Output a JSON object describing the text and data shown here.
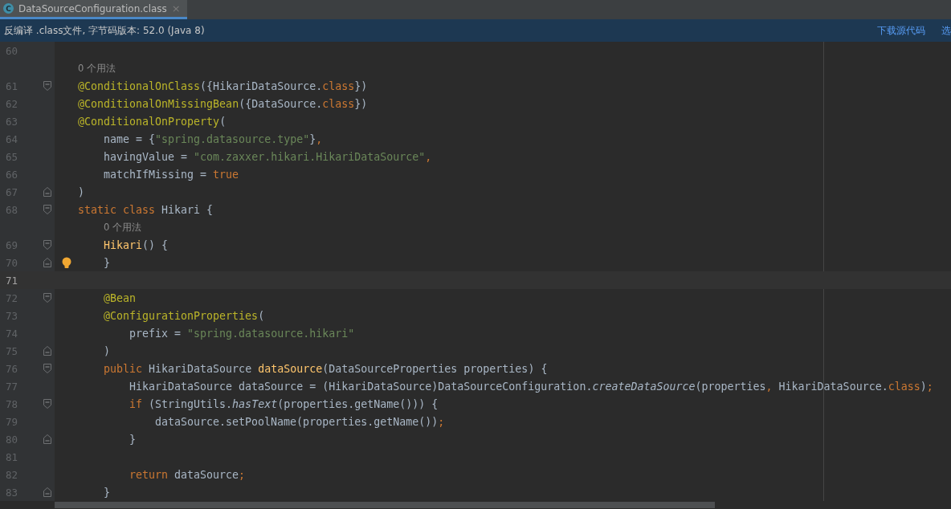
{
  "tab": {
    "icon": "C",
    "title": "DataSourceConfiguration.class",
    "close": "×",
    "selected": true
  },
  "info_bar": {
    "message": "反编译 .class文件, 字节码版本: 52.0 (Java 8)",
    "links": [
      "下载源代码",
      "选"
    ]
  },
  "lines": [
    {
      "kind": "code",
      "number": "60",
      "block_start": false,
      "block_end": false,
      "bulb": false,
      "current": false
    },
    {
      "kind": "hint",
      "text": "0 个用法"
    },
    {
      "kind": "code",
      "number": "61",
      "block_start": true,
      "block_end": false,
      "bulb": false,
      "current": false,
      "tokens": [
        {
          "kind": "annotation",
          "text": "@ConditionalOnClass"
        },
        {
          "kind": "plain",
          "text": "({HikariDataSource."
        },
        {
          "kind": "keyword",
          "text": "class"
        },
        {
          "kind": "plain",
          "text": "})"
        }
      ]
    },
    {
      "kind": "code",
      "number": "62",
      "block_start": false,
      "block_end": false,
      "bulb": false,
      "current": false,
      "tokens": [
        {
          "kind": "annotation",
          "text": "@ConditionalOnMissingBean"
        },
        {
          "kind": "plain",
          "text": "({DataSource."
        },
        {
          "kind": "keyword",
          "text": "class"
        },
        {
          "kind": "plain",
          "text": "})"
        }
      ]
    },
    {
      "kind": "code",
      "number": "63",
      "block_start": false,
      "block_end": false,
      "bulb": false,
      "current": false,
      "tokens": [
        {
          "kind": "annotation",
          "text": "@ConditionalOnProperty"
        },
        {
          "kind": "plain",
          "text": "("
        }
      ],
      "children": [
        {
          "kind": "code",
          "number": "64",
          "block_start": false,
          "block_end": false,
          "bulb": false,
          "current": false,
          "tokens": [
            {
              "kind": "plain",
              "text": "name = {"
            },
            {
              "kind": "string",
              "text": "\"spring.datasource.type\""
            },
            {
              "kind": "plain",
              "text": "}"
            },
            {
              "kind": "keyword",
              "text": ","
            }
          ]
        },
        {
          "kind": "code",
          "number": "65",
          "block_start": false,
          "block_end": false,
          "bulb": false,
          "current": false,
          "tokens": [
            {
              "kind": "plain",
              "text": "havingValue = "
            },
            {
              "kind": "string",
              "text": "\"com.zaxxer.hikari.HikariDataSource\""
            },
            {
              "kind": "keyword",
              "text": ","
            }
          ]
        },
        {
          "kind": "code",
          "number": "66",
          "block_start": false,
          "block_end": false,
          "bulb": false,
          "current": false,
          "tokens": [
            {
              "kind": "plain",
              "text": "matchIfMissing = "
            },
            {
              "kind": "keyword",
              "text": "true"
            }
          ]
        }
      ]
    },
    {
      "kind": "code",
      "number": "67",
      "block_start": false,
      "block_end": true,
      "bulb": false,
      "current": false,
      "tokens": [
        {
          "kind": "plain",
          "text": ")"
        }
      ]
    },
    {
      "kind": "code",
      "number": "68",
      "block_start": true,
      "block_end": false,
      "bulb": false,
      "current": false,
      "tokens": [
        {
          "kind": "keyword",
          "text": "static class "
        },
        {
          "kind": "plain",
          "text": "Hikari {"
        }
      ],
      "children": [
        {
          "kind": "hint",
          "text": "0 个用法"
        },
        {
          "kind": "code",
          "number": "69",
          "block_start": true,
          "block_end": false,
          "bulb": false,
          "current": false,
          "tokens": [
            {
              "kind": "method",
              "text": "Hikari"
            },
            {
              "kind": "plain",
              "text": "() {"
            }
          ]
        },
        {
          "kind": "code",
          "number": "70",
          "block_start": false,
          "block_end": true,
          "bulb": true,
          "current": false,
          "tokens": [
            {
              "kind": "plain",
              "text": "}"
            }
          ]
        },
        {
          "kind": "code",
          "number": "71",
          "block_start": false,
          "block_end": false,
          "bulb": false,
          "current": true
        },
        {
          "kind": "code",
          "number": "72",
          "block_start": true,
          "block_end": false,
          "bulb": false,
          "current": false,
          "tokens": [
            {
              "kind": "annotation",
              "text": "@Bean"
            }
          ]
        },
        {
          "kind": "code",
          "number": "73",
          "block_start": false,
          "block_end": false,
          "bulb": false,
          "current": false,
          "tokens": [
            {
              "kind": "annotation",
              "text": "@ConfigurationProperties"
            },
            {
              "kind": "plain",
              "text": "("
            }
          ],
          "children": [
            {
              "kind": "code",
              "number": "74",
              "block_start": false,
              "block_end": false,
              "bulb": false,
              "current": false,
              "tokens": [
                {
                  "kind": "plain",
                  "text": "prefix = "
                },
                {
                  "kind": "string",
                  "text": "\"spring.datasource.hikari\""
                }
              ]
            }
          ]
        },
        {
          "kind": "code",
          "number": "75",
          "block_start": false,
          "block_end": true,
          "bulb": false,
          "current": false,
          "tokens": [
            {
              "kind": "plain",
              "text": ")"
            }
          ]
        },
        {
          "kind": "code",
          "number": "76",
          "block_start": true,
          "block_end": false,
          "bulb": false,
          "current": false,
          "tokens": [
            {
              "kind": "keyword",
              "text": "public "
            },
            {
              "kind": "plain",
              "text": "HikariDataSource "
            },
            {
              "kind": "method",
              "text": "dataSource"
            },
            {
              "kind": "plain",
              "text": "(DataSourceProperties properties) {"
            }
          ],
          "children": [
            {
              "kind": "code",
              "number": "77",
              "block_start": false,
              "block_end": false,
              "bulb": false,
              "current": false,
              "tokens": [
                {
                  "kind": "plain",
                  "text": "HikariDataSource dataSource = (HikariDataSource)DataSourceConfiguration."
                },
                {
                  "kind": "static_call",
                  "text": "createDataSource"
                },
                {
                  "kind": "plain",
                  "text": "(properties"
                },
                {
                  "kind": "keyword",
                  "text": ","
                },
                {
                  "kind": "plain",
                  "text": " HikariDataSource."
                },
                {
                  "kind": "keyword",
                  "text": "class"
                },
                {
                  "kind": "plain",
                  "text": ")"
                },
                {
                  "kind": "keyword",
                  "text": ";"
                }
              ]
            },
            {
              "kind": "code",
              "number": "78",
              "block_start": true,
              "block_end": false,
              "bulb": false,
              "current": false,
              "tokens": [
                {
                  "kind": "keyword",
                  "text": "if "
                },
                {
                  "kind": "plain",
                  "text": "(StringUtils."
                },
                {
                  "kind": "static_call",
                  "text": "hasText"
                },
                {
                  "kind": "plain",
                  "text": "(properties.getName())) {"
                }
              ],
              "children": [
                {
                  "kind": "code",
                  "number": "79",
                  "block_start": false,
                  "block_end": false,
                  "bulb": false,
                  "current": false,
                  "tokens": [
                    {
                      "kind": "plain",
                      "text": "dataSource.setPoolName(properties.getName())"
                    },
                    {
                      "kind": "keyword",
                      "text": ";"
                    }
                  ]
                }
              ]
            },
            {
              "kind": "code",
              "number": "80",
              "block_start": false,
              "block_end": true,
              "bulb": false,
              "current": false,
              "tokens": [
                {
                  "kind": "plain",
                  "text": "}"
                }
              ]
            },
            {
              "kind": "code",
              "number": "81",
              "block_start": false,
              "block_end": false,
              "bulb": false,
              "current": false
            },
            {
              "kind": "code",
              "number": "82",
              "block_start": false,
              "block_end": false,
              "bulb": false,
              "current": false,
              "tokens": [
                {
                  "kind": "keyword",
                  "text": "return "
                },
                {
                  "kind": "plain",
                  "text": "dataSource"
                },
                {
                  "kind": "keyword",
                  "text": ";"
                }
              ]
            }
          ]
        },
        {
          "kind": "code",
          "number": "83",
          "block_start": false,
          "block_end": true,
          "bulb": false,
          "current": false,
          "tokens": [
            {
              "kind": "plain",
              "text": "}"
            }
          ]
        }
      ]
    }
  ]
}
